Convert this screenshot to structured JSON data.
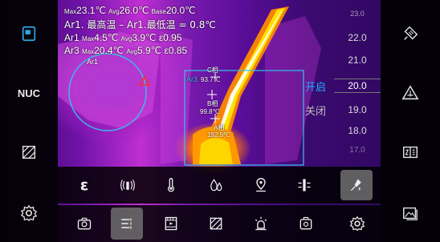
{
  "stats": {
    "line1": {
      "max_prefix": "Max",
      "max_val": "23.1℃",
      "avg_prefix": "Avg",
      "avg_val": "26.0℃",
      "base_prefix": "Base",
      "base_val": "20.0℃"
    },
    "line2": "Ar1. 最高温 – Ar1.最低温 = 0.8℃",
    "line3": {
      "label": "Ar1",
      "max_prefix": "Max",
      "max_val": "4.5℃",
      "avg_prefix": "Avg",
      "avg_val": "3.9℃",
      "eps_val": "ε0.95"
    },
    "line4": {
      "label": "Ar3",
      "max_prefix": "Max",
      "max_val": "20.4℃",
      "avg_prefix": "Avg",
      "avg_val": "5.9℃",
      "eps_val": "ε0.85"
    }
  },
  "area1_label": "Ar1",
  "box_area": {
    "label": "Ar3",
    "point_c": "C相",
    "point_c_val": "93.7℃",
    "point_b": "B相",
    "point_b_val": "99.8℃",
    "point_a": "A相",
    "point_a_val": "192.9℃"
  },
  "scale": [
    "23.0",
    "22.0",
    "21.0",
    "20.0",
    "19.0",
    "18.0",
    "17.0"
  ],
  "scale_selected": "20.0",
  "toggle": {
    "open": "开启",
    "close": "关闭"
  },
  "left_panel": {
    "nuc": "NUC"
  },
  "toolbar_row1": [
    {
      "name": "emissivity-button",
      "glyph": "ε"
    },
    {
      "name": "signal-button"
    },
    {
      "name": "thermometer-button"
    },
    {
      "name": "humidity-button"
    },
    {
      "name": "location-button"
    },
    {
      "name": "isotherm-button"
    },
    {
      "name": "temp-probe-button"
    }
  ],
  "colors": {
    "accent": "#00c8ff",
    "open_text": "#1ab0ff",
    "close_text": "#bfbfbf",
    "marker": "#ff2b2b"
  }
}
